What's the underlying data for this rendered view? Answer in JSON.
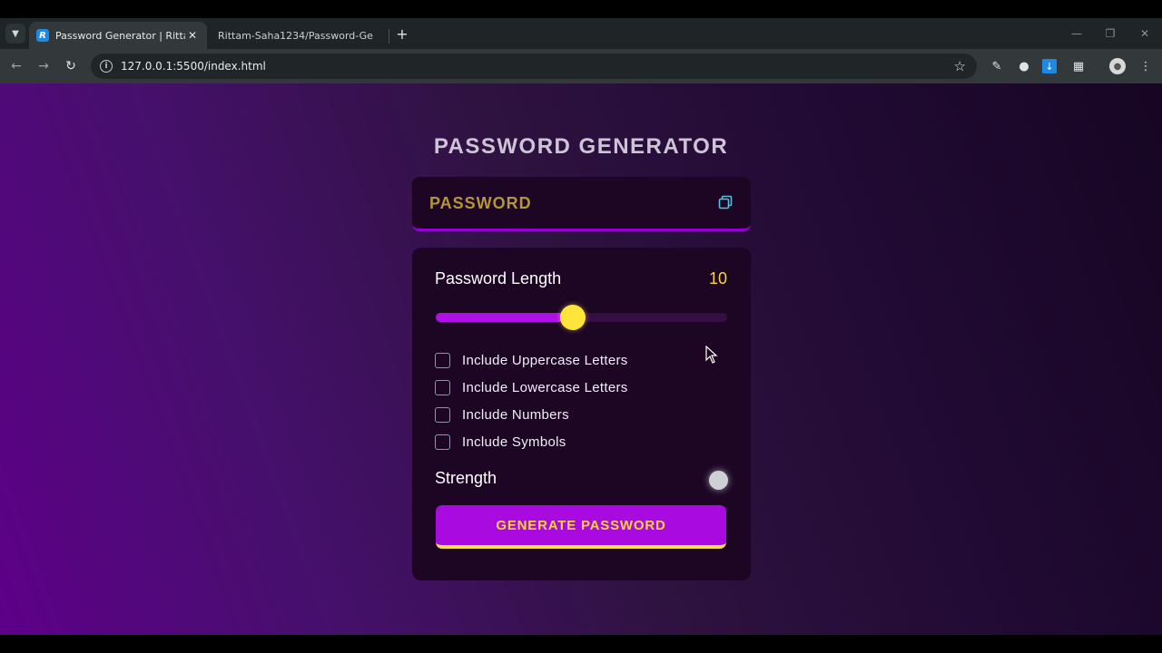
{
  "browser": {
    "tabs": [
      {
        "title": "Password Generator | Rittam Sa",
        "favicon": "R",
        "active": true
      },
      {
        "title": "Rittam-Saha1234/Password-Ge",
        "active": false
      }
    ],
    "url": "127.0.0.1:5500/index.html"
  },
  "app": {
    "title": "PASSWORD GENERATOR",
    "display": {
      "placeholder": "PASSWORD",
      "icon": "copy-icon"
    },
    "length": {
      "label": "Password Length",
      "value": "10",
      "slider_fraction": 0.47
    },
    "options": [
      {
        "label": "Include Uppercase Letters",
        "checked": false
      },
      {
        "label": "Include Lowercase Letters",
        "checked": false
      },
      {
        "label": "Include Numbers",
        "checked": false
      },
      {
        "label": "Include Symbols",
        "checked": false
      }
    ],
    "strength": {
      "label": "Strength",
      "color": "#cfcfd6"
    },
    "generate_label": "GENERATE PASSWORD"
  },
  "colors": {
    "accent": "#a90ae0",
    "highlight": "#ffd43b",
    "card": "#1c0624"
  }
}
